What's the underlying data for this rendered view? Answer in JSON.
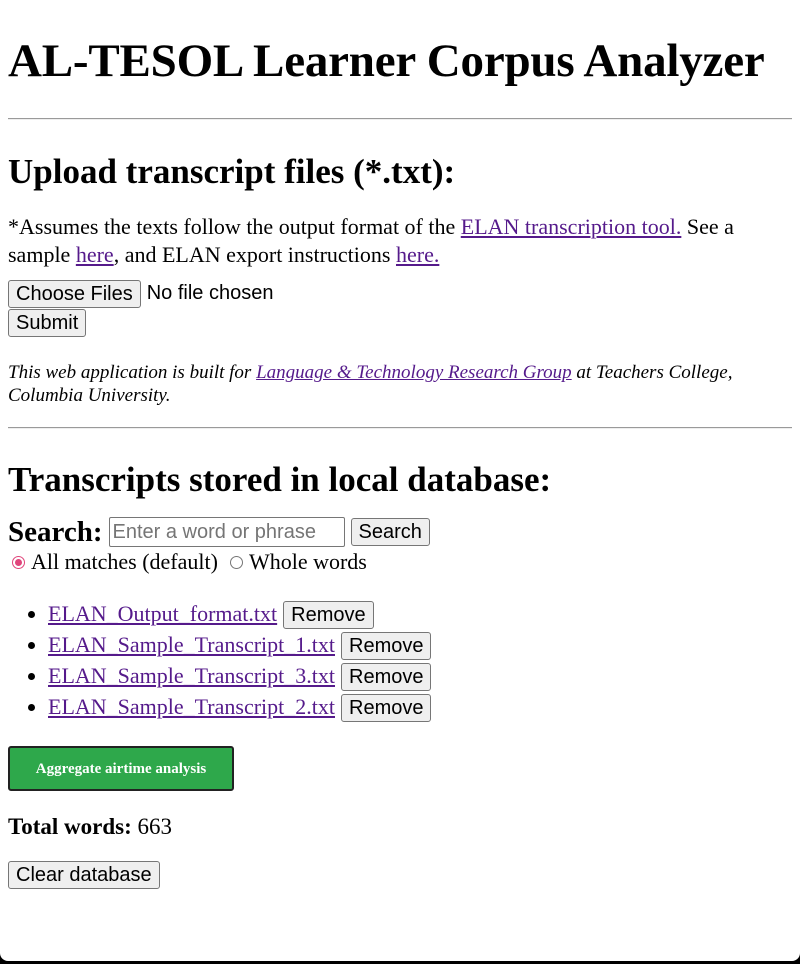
{
  "title": "AL-TESOL Learner Corpus Analyzer",
  "upload": {
    "heading": "Upload transcript files (*.txt):",
    "note_prefix": "*Assumes the texts follow the output format of the ",
    "elan_link": "ELAN transcription tool.",
    "note_mid1": " See a sample ",
    "sample_link": "here",
    "note_mid2": ", and ELAN export instructions ",
    "instructions_link": "here.",
    "choose_files_label": "Choose Files",
    "file_status": "No file chosen",
    "submit_label": "Submit"
  },
  "credit": {
    "prefix": "This web application is built for ",
    "group_link": "Language & Technology Research Group",
    "suffix": " at Teachers College, Columbia University."
  },
  "database": {
    "heading": "Transcripts stored in local database:",
    "search_label": "Search:",
    "search_placeholder": "Enter a word or phrase",
    "search_value": "",
    "search_button": "Search",
    "radio_options": [
      {
        "label": "All matches (default)",
        "checked": true
      },
      {
        "label": "Whole words",
        "checked": false
      }
    ],
    "files": [
      {
        "name": "ELAN_Output_format.txt",
        "remove_label": "Remove"
      },
      {
        "name": "ELAN_Sample_Transcript_1.txt",
        "remove_label": "Remove"
      },
      {
        "name": "ELAN_Sample_Transcript_3.txt",
        "remove_label": "Remove"
      },
      {
        "name": "ELAN_Sample_Transcript_2.txt",
        "remove_label": "Remove"
      }
    ],
    "aggregate_button": "Aggregate airtime analysis",
    "total_label": "Total words:",
    "total_value": "663",
    "clear_button": "Clear database"
  },
  "colors": {
    "link": "#551a8b",
    "aggregate_button_bg": "#2ea84b",
    "radio_accent": "#e0457b"
  }
}
